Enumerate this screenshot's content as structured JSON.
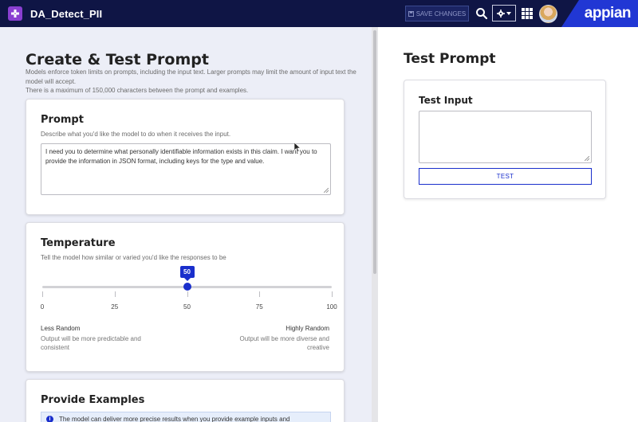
{
  "topbar": {
    "app_title": "DA_Detect_PII",
    "save_label": "SAVE CHANGES",
    "brand": "appian"
  },
  "left": {
    "title": "Create & Test Prompt",
    "subtitle_line1": "Models enforce token limits on prompts, including the input text. Larger prompts may limit the amount of input text the model will accept.",
    "subtitle_line2": "There is a maximum of 150,000 characters between the prompt and examples."
  },
  "prompt_card": {
    "title": "Prompt",
    "description": "Describe what you'd like the model to do when it receives the input.",
    "value": "I need you to determine what personally identifiable information exists in this claim. I want you to provide the information in JSON format, including keys for the type and value."
  },
  "temperature_card": {
    "title": "Temperature",
    "description": "Tell the model how similar or varied you'd like the responses to be",
    "value": 50,
    "min": 0,
    "max": 100,
    "ticks": [
      "0",
      "25",
      "50",
      "75",
      "100"
    ],
    "left_label": "Less Random",
    "left_note": "Output will be more predictable and consistent",
    "right_label": "Highly Random",
    "right_note": "Output will be more diverse and creative"
  },
  "examples_card": {
    "title": "Provide Examples",
    "info": "The model can deliver more precise results when you provide example inputs and"
  },
  "right": {
    "title": "Test Prompt",
    "input_label": "Test Input",
    "input_value": "",
    "test_button": "TEST"
  },
  "colors": {
    "topbar": "#0f1545",
    "accent": "#1a2fcc",
    "brand_bg": "#2137d4",
    "app_icon": "#8a3fd1"
  },
  "icons": {
    "app": "plus-icon",
    "save": "save-icon",
    "search": "search-icon",
    "settings": "gear-icon",
    "apps": "grid-icon",
    "info": "info-icon"
  }
}
